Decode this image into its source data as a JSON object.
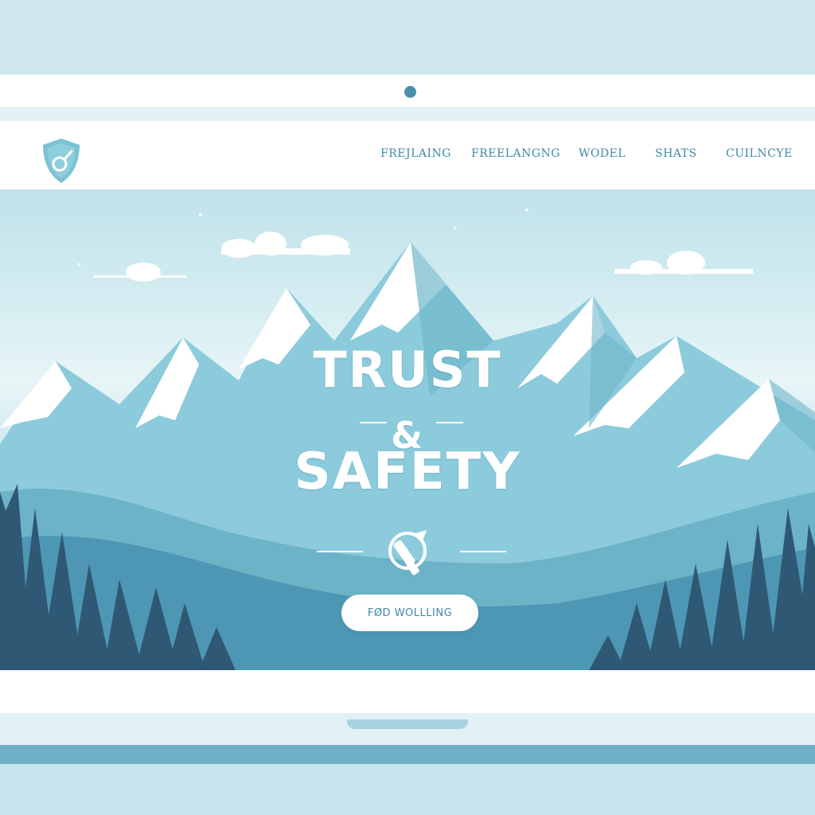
{
  "nav": {
    "links": [
      {
        "label": "FREJLAING"
      },
      {
        "label": "FREELANGNG"
      },
      {
        "label": "WODEL"
      },
      {
        "label": "SHATS"
      },
      {
        "label": "CUILNCYE"
      }
    ]
  },
  "hero": {
    "title_line1": "TRUST",
    "title_amp": "&",
    "title_line2": "SAFETY",
    "cta_label": "FØD WOLLLING"
  },
  "icons": {
    "logo": "shield-icon",
    "emblem": "tool-emblem-icon",
    "camera": "webcam-dot"
  },
  "colors": {
    "accent": "#3f8aa6",
    "sky": "#cfe8ee",
    "mountain": "#7bbfd2",
    "forest": "#2f5875"
  }
}
